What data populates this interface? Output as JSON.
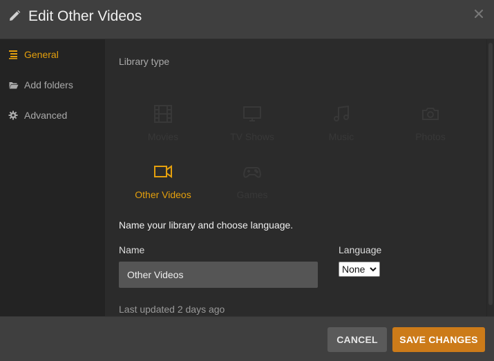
{
  "header": {
    "title": "Edit Other Videos"
  },
  "sidebar": {
    "items": [
      {
        "label": "General",
        "icon": "list-icon",
        "active": true
      },
      {
        "label": "Add folders",
        "icon": "folder-icon",
        "active": false
      },
      {
        "label": "Advanced",
        "icon": "gear-icon",
        "active": false
      }
    ]
  },
  "library": {
    "section_label": "Library type",
    "types": [
      {
        "label": "Movies",
        "icon": "film-icon",
        "selected": false
      },
      {
        "label": "TV Shows",
        "icon": "tv-icon",
        "selected": false
      },
      {
        "label": "Music",
        "icon": "music-icon",
        "selected": false
      },
      {
        "label": "Photos",
        "icon": "camera-icon",
        "selected": false
      },
      {
        "label": "Other Videos",
        "icon": "video-camera-icon",
        "selected": true
      },
      {
        "label": "Games",
        "icon": "gamepad-icon",
        "selected": false
      }
    ]
  },
  "form": {
    "prompt": "Name your library and choose language.",
    "name_label": "Name",
    "name_value": "Other Videos",
    "language_label": "Language",
    "language_value": "None",
    "last_updated": "Last updated 2 days ago"
  },
  "footer": {
    "cancel_label": "CANCEL",
    "save_label": "SAVE CHANGES"
  },
  "colors": {
    "accent": "#e5a00d",
    "save_button": "#cc7b19",
    "cancel_button": "#5a5a5a",
    "sidebar_bg": "#232323",
    "content_bg": "#2b2b2b",
    "header_bg": "#3f3f3f"
  }
}
